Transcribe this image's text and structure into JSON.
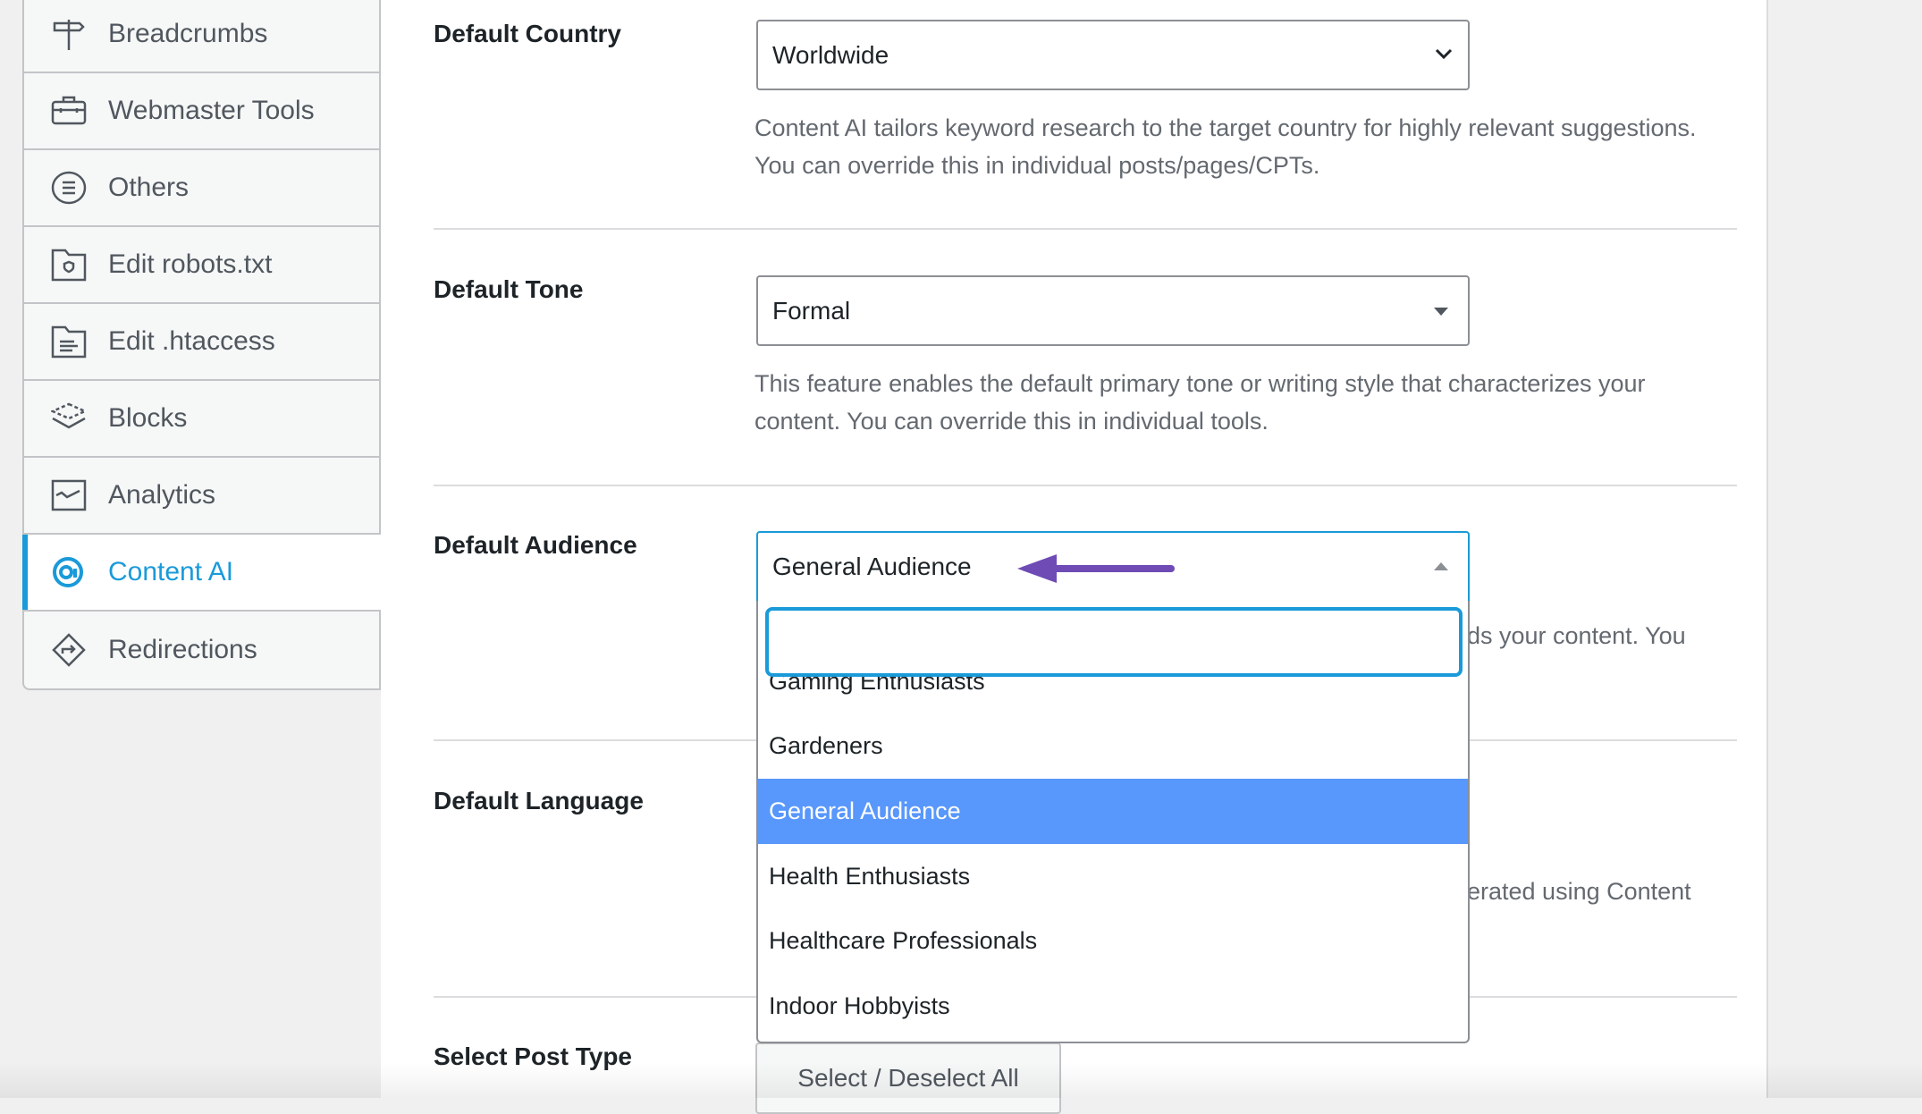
{
  "sidebar": {
    "items": [
      {
        "label": "Breadcrumbs",
        "icon": "signpost-icon"
      },
      {
        "label": "Webmaster Tools",
        "icon": "toolbox-icon"
      },
      {
        "label": "Others",
        "icon": "list-circle-icon"
      },
      {
        "label": "Edit robots.txt",
        "icon": "folder-shield-icon"
      },
      {
        "label": "Edit .htaccess",
        "icon": "folder-text-icon"
      },
      {
        "label": "Blocks",
        "icon": "blocks-icon"
      },
      {
        "label": "Analytics",
        "icon": "analytics-icon"
      },
      {
        "label": "Content AI",
        "icon": "content-ai-icon",
        "active": true
      },
      {
        "label": "Redirections",
        "icon": "redirect-icon"
      }
    ]
  },
  "colors": {
    "accent": "#1a9ad9",
    "highlight": "#5897fb",
    "arrow": "#6f4bb5"
  },
  "settings": {
    "country": {
      "label": "Default Country",
      "value": "Worldwide",
      "help": "Content AI tailors keyword research to the target country for highly relevant suggestions. You can override this in individual posts/pages/CPTs."
    },
    "tone": {
      "label": "Default Tone",
      "value": "Formal",
      "help": "This feature enables the default primary tone or writing style that characterizes your content. You can override this in individual tools."
    },
    "audience": {
      "label": "Default Audience",
      "value": "General Audience",
      "help_fragment": "ds your content. You",
      "search_value": "",
      "options": [
        "Gaming Enthusiasts",
        "Gardeners",
        "General Audience",
        "Health Enthusiasts",
        "Healthcare Professionals",
        "Indoor Hobbyists"
      ],
      "selected": "General Audience"
    },
    "language": {
      "label": "Default Language",
      "help_fragment": "erated using Content"
    },
    "post_type": {
      "label": "Select Post Type",
      "button": "Select / Deselect All"
    }
  }
}
